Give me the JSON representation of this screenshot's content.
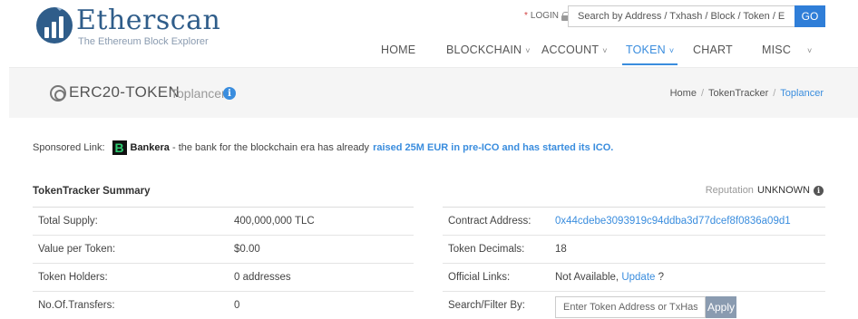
{
  "brand": {
    "name": "Etherscan",
    "tagline": "The Ethereum Block Explorer"
  },
  "header": {
    "login_star": "*",
    "login_label": "LOGIN",
    "search_placeholder": "Search by Address / Txhash / Block / Token / Ens",
    "go_label": "GO"
  },
  "nav": {
    "items": [
      {
        "label": "HOME"
      },
      {
        "label": "BLOCKCHAIN",
        "chevron": "˅"
      },
      {
        "label": "ACCOUNT",
        "chevron": "˅"
      },
      {
        "label": "TOKEN",
        "chevron": "˅",
        "active": true
      },
      {
        "label": "CHART"
      },
      {
        "label": "MISC"
      },
      {
        "chevron": "˅"
      }
    ]
  },
  "title": {
    "main": "ERC20-TOKEN",
    "sub": "Toplancer",
    "info": "i"
  },
  "breadcrumb": [
    "Home",
    "TokenTracker",
    "Toplancer"
  ],
  "sponsored": {
    "prefix": "Sponsored Link:",
    "logo_letter": "B",
    "brand": "Bankera",
    "text": " - the bank for the blockchain era has already",
    "highlight": "raised 25M EUR in pre-ICO and has started its ICO."
  },
  "summary": {
    "title": "TokenTracker Summary",
    "reputation_label": "Reputation",
    "reputation_value": "UNKNOWN",
    "reputation_info": "i",
    "left_rows": [
      {
        "label": "Total Supply:",
        "value": "400,000,000 TLC"
      },
      {
        "label": "Value per Token:",
        "value": "$0.00"
      },
      {
        "label": "Token Holders:",
        "value": "0 addresses"
      },
      {
        "label": "No.Of.Transfers:",
        "value": "0"
      }
    ],
    "right_rows": {
      "contract_label": "Contract Address:",
      "contract_value": "0x44cdebe3093919c94ddba3d77dcef8f0836a09d1",
      "decimals_label": "Token Decimals:",
      "decimals_value": "18",
      "links_label": "Official Links:",
      "links_value": "Not Available,",
      "links_update": "Update",
      "links_q": "?",
      "filter_label": "Search/Filter By:",
      "filter_placeholder": "Enter Token Address or TxHash",
      "apply_label": "Apply"
    }
  },
  "colors": {
    "brand": "#2f5d8a",
    "accent": "#3a8dde",
    "go_button": "#2f7ed8",
    "apply_button": "#8a9bb0"
  }
}
